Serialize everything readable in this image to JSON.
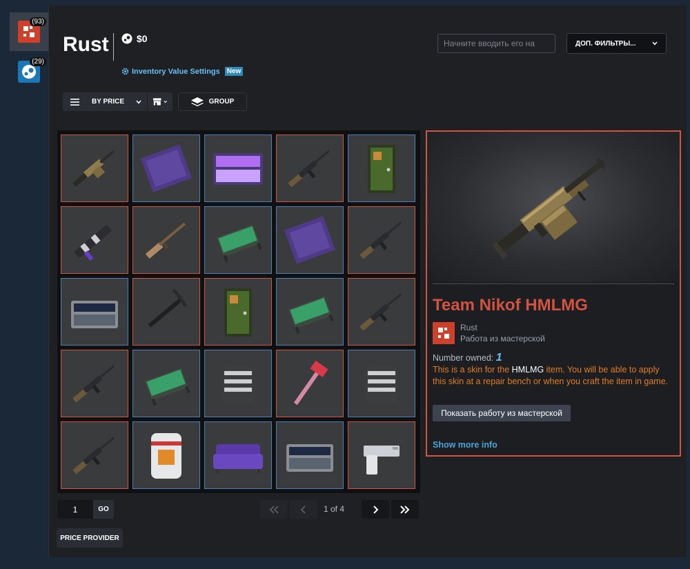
{
  "colors": {
    "page_bg": "#1b2838",
    "panel_bg": "#1e2024",
    "accent_red": "#d05540",
    "accent_blue": "#66c0f4",
    "description_orange": "#e17e1f",
    "rarity_covert": "#d05540",
    "rarity_blue": "#4d7fb5"
  },
  "sidebar": {
    "games": [
      {
        "icon": "rust-logo-icon",
        "count": "(93)",
        "active": true
      },
      {
        "icon": "steam-logo-icon",
        "count": "(29)",
        "active": false
      }
    ]
  },
  "header": {
    "title": "Rust",
    "wallet_icon": "steam-icon",
    "wallet_value": "$0",
    "settings_icon": "gear-icon",
    "settings_link": "Inventory Value Settings",
    "new_badge": "New",
    "search_placeholder": "Начните вводить его на",
    "filters_label": "ДОП. ФИЛЬТРЫ..."
  },
  "toolbar": {
    "sort_label": "BY PRICE",
    "group_label": "GROUP"
  },
  "inventory": {
    "items": [
      {
        "icon": "machine-gun-icon",
        "border": "red"
      },
      {
        "icon": "rug-icon",
        "border": "blue"
      },
      {
        "icon": "twitch-rivals-logo-icon",
        "border": "blue"
      },
      {
        "icon": "rifle-icon",
        "border": "red"
      },
      {
        "icon": "door-icon",
        "border": "blue"
      },
      {
        "icon": "launcher-icon",
        "border": "red"
      },
      {
        "icon": "shotgun-icon",
        "border": "red"
      },
      {
        "icon": "bed-icon",
        "border": "blue"
      },
      {
        "icon": "rug-icon",
        "border": "blue"
      },
      {
        "icon": "rifle-icon",
        "border": "red"
      },
      {
        "icon": "crate-icon",
        "border": "blue"
      },
      {
        "icon": "pickaxe-icon",
        "border": "red"
      },
      {
        "icon": "door-icon",
        "border": "red"
      },
      {
        "icon": "bed-icon",
        "border": "blue"
      },
      {
        "icon": "rifle-icon",
        "border": "red"
      },
      {
        "icon": "rifle-icon",
        "border": "red"
      },
      {
        "icon": "bed-icon",
        "border": "blue"
      },
      {
        "icon": "armor-icon",
        "border": "blue"
      },
      {
        "icon": "hatchet-icon",
        "border": "red"
      },
      {
        "icon": "armor-icon",
        "border": "blue"
      },
      {
        "icon": "rifle-icon",
        "border": "red"
      },
      {
        "icon": "furnace-icon",
        "border": "blue"
      },
      {
        "icon": "sofa-icon",
        "border": "blue"
      },
      {
        "icon": "crate-icon",
        "border": "blue"
      },
      {
        "icon": "pistol-icon",
        "border": "red"
      }
    ]
  },
  "detail": {
    "image_icon": "machine-gun-icon",
    "name": "Team Nikof HMLMG",
    "game_name": "Rust",
    "game_sub": "Работа из мастерской",
    "owned_label": "Number owned:",
    "owned_count": "1",
    "desc_1": "This is a skin for the",
    "desc_item": "HMLMG",
    "desc_2": "item. You will be able to apply this skin at a repair bench or when you craft the item in game.",
    "workshop_button": "Показать работу из мастерской",
    "more_info": "Show more info"
  },
  "pagination": {
    "input_value": "1",
    "go_label": "GO",
    "page_label": "1 of 4"
  },
  "footer": {
    "price_provider": "PRICE PROVIDER"
  }
}
